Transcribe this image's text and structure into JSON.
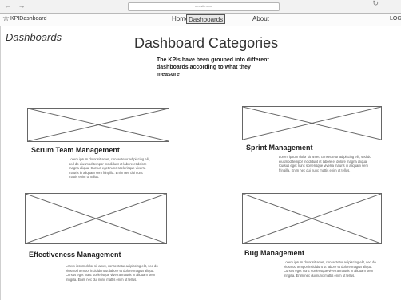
{
  "browser": {
    "nav_arrows": "← →",
    "url": "newsite.com",
    "reload_icon": "reload-icon"
  },
  "app_nav": {
    "star_icon": "star-icon",
    "app_name": "KPIDashboard",
    "links": [
      "Home",
      "Dashboards",
      "About",
      "LOGIN"
    ],
    "active": "Dashboards"
  },
  "page": {
    "section_title": "Dashboards",
    "main_title": "Dashboard Categories",
    "subtitle": "The KPIs have been grouped into different dashboards according to what they measure"
  },
  "cards": [
    {
      "title": "Scrum Team Management",
      "image": "placeholder-image",
      "description": "Lorem ipsum dolor sit amet, consectetur adipiscing elit, sed do eiusmod tempor incididunt ut labore et dolore magna aliqua. Cursus eget nunc scelerisque viverra mauris in aliquam sem fringilla. Enim nec dui nunc mattis enim ut tellus."
    },
    {
      "title": "Sprint Management",
      "image": "placeholder-image",
      "description": "Lorem ipsum dolor sit amet, consectetur adipiscing elit, sed do eiusmod tempor incididunt ut labore et dolore magna aliqua. Cursus eget nunc scelerisque viverra mauris in aliquam sem fringilla. Enim nec dui nunc mattis enim ut tellus."
    },
    {
      "title": "Effectiveness Management",
      "image": "placeholder-image",
      "description": "Lorem ipsum dolor sit amet, consectetur adipiscing elit, sed do eiusmod tempor incididunt ut labore et dolore magna aliqua. Cursus eget nunc scelerisque viverra mauris in aliquam sem fringilla. Enim nec dui nunc mattis enim ut tellus."
    },
    {
      "title": "Bug Management",
      "image": "placeholder-image",
      "description": "Lorem ipsum dolor sit amet, consectetur adipiscing elit, sed do eiusmod tempor incididunt ut labore et dolore magna aliqua. Cursus eget nunc scelerisque viverra mauris in aliquam sem fringilla. Enim nec dui nunc mattis enim ut tellus."
    }
  ]
}
